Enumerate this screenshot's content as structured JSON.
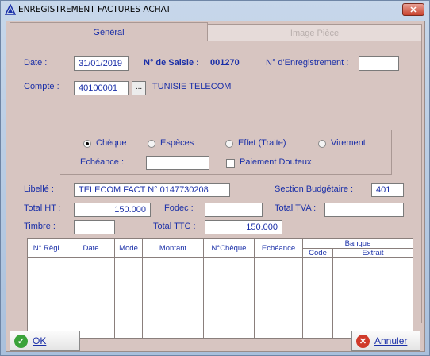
{
  "window": {
    "title": "ENREGISTREMENT FACTURES ACHAT",
    "close_label": "✕"
  },
  "tabs": [
    {
      "label": "Général",
      "active": true
    },
    {
      "label": "Image Pièce",
      "active": false
    }
  ],
  "form": {
    "date_label": "Date :",
    "date_value": "31/01/2019",
    "saisie_label": "N° de Saisie :",
    "saisie_value": "001270",
    "enreg_label": "N° d'Enregistrement :",
    "enreg_value": "",
    "compte_label": "Compte :",
    "compte_value": "40100001",
    "compte_browse": "...",
    "compte_name": "TUNISIE TELECOM",
    "payment": {
      "options": [
        "Chèque",
        "Espèces",
        "Effet (Traite)",
        "Virement"
      ],
      "selected": "Chèque",
      "echeance_label": "Echéance :",
      "echeance_value": "",
      "douteux_label": "Paiement Douteux",
      "douteux_checked": false
    },
    "libelle_label": "Libellé :",
    "libelle_value": "TELECOM FACT N° 0147730208",
    "section_label": "Section Budgétaire :",
    "section_value": "401",
    "total_ht_label": "Total HT :",
    "total_ht_value": "150.000",
    "fodec_label": "Fodec :",
    "fodec_value": "",
    "total_tva_label": "Total TVA :",
    "total_tva_value": "",
    "timbre_label": "Timbre :",
    "timbre_value": "",
    "total_ttc_label": "Total TTC :",
    "total_ttc_value": "150.000"
  },
  "grid": {
    "columns": [
      "N° Règl.",
      "Date",
      "Mode",
      "Montant",
      "N°Chèque",
      "Echéance"
    ],
    "banque_header": "Banque",
    "banque_sub": [
      "Code",
      "Extrait"
    ],
    "rows": []
  },
  "footer": {
    "ok_label": "OK",
    "cancel_label": "Annuler"
  },
  "colors": {
    "accent_text": "#1a2fa8",
    "panel_bg": "#d7c5c1",
    "title_bg": "#c7d7ea"
  }
}
